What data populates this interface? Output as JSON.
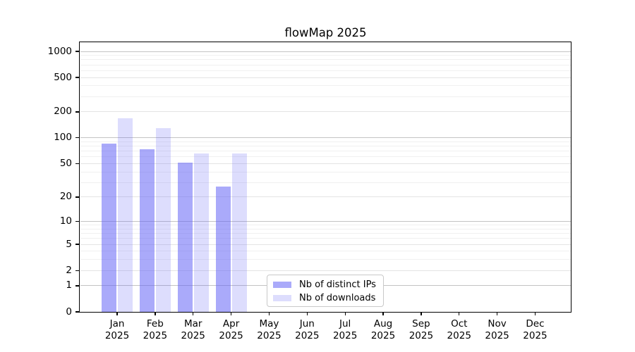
{
  "chart_data": {
    "type": "bar",
    "title": "flowMap 2025",
    "scale": "log1p",
    "ylim": [
      0,
      1000
    ],
    "grid": true,
    "legend_position": "bottom-center",
    "y_ticks": [
      0,
      1,
      2,
      5,
      10,
      20,
      50,
      100,
      200,
      500,
      1000
    ],
    "y_decade_ticks": [
      1,
      10,
      100,
      1000
    ],
    "y_minor_gridlines": [
      3,
      4,
      6,
      7,
      8,
      9,
      30,
      40,
      60,
      70,
      80,
      90,
      300,
      400,
      600,
      700,
      800,
      900
    ],
    "categories": [
      "Jan",
      "Feb",
      "Mar",
      "Apr",
      "May",
      "Jun",
      "Jul",
      "Aug",
      "Sep",
      "Oct",
      "Nov",
      "Dec"
    ],
    "x_year": "2025",
    "series": [
      {
        "name": "Nb of distinct IPs",
        "color": "rgba(100,100,245,0.55)",
        "values": [
          85,
          74,
          51,
          27,
          null,
          null,
          null,
          null,
          null,
          null,
          null,
          null
        ]
      },
      {
        "name": "Nb of downloads",
        "color": "rgba(100,100,245,0.22)",
        "values": [
          170,
          130,
          66,
          66,
          null,
          null,
          null,
          null,
          null,
          null,
          null,
          null
        ]
      }
    ]
  },
  "colors": {
    "background": "#ffffff",
    "axis": "#000000",
    "grid_major": "#c3c3c3",
    "grid_mid": "#e4e4e4",
    "grid_minor": "#f0f0f0",
    "legend_border": "#c9c9c9"
  }
}
